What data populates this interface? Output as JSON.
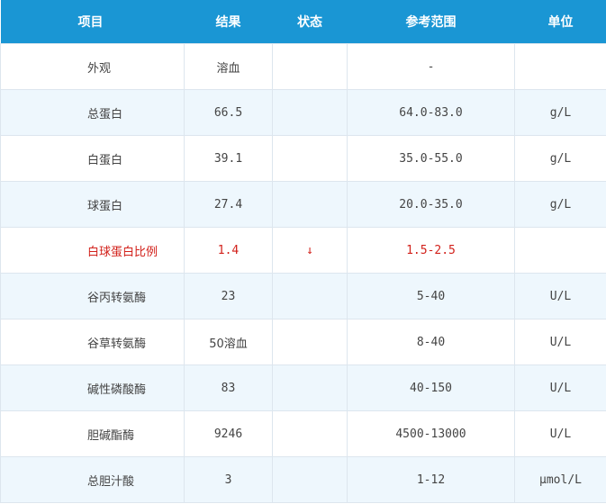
{
  "headers": {
    "item": "项目",
    "result": "结果",
    "status": "状态",
    "reference": "参考范围",
    "unit": "单位"
  },
  "rows": [
    {
      "item": "外观",
      "result": "溶血",
      "status": "",
      "reference": "-",
      "unit": ""
    },
    {
      "item": "总蛋白",
      "result": "66.5",
      "status": "",
      "reference": "64.0-83.0",
      "unit": "g/L"
    },
    {
      "item": "白蛋白",
      "result": "39.1",
      "status": "",
      "reference": "35.0-55.0",
      "unit": "g/L"
    },
    {
      "item": "球蛋白",
      "result": "27.4",
      "status": "",
      "reference": "20.0-35.0",
      "unit": "g/L"
    },
    {
      "item": "白球蛋白比例",
      "result": "1.4",
      "status": "↓",
      "reference": "1.5-2.5",
      "unit": ""
    },
    {
      "item": "谷丙转氨酶",
      "result": "23",
      "status": "",
      "reference": "5-40",
      "unit": "U/L"
    },
    {
      "item": "谷草转氨酶",
      "result": "50溶血",
      "status": "",
      "reference": "8-40",
      "unit": "U/L"
    },
    {
      "item": "碱性磷酸酶",
      "result": "83",
      "status": "",
      "reference": "40-150",
      "unit": "U/L"
    },
    {
      "item": "胆碱酯酶",
      "result": "9246",
      "status": "",
      "reference": "4500-13000",
      "unit": "U/L"
    },
    {
      "item": "总胆汁酸",
      "result": "3",
      "status": "",
      "reference": "1-12",
      "unit": "μmol/L"
    }
  ],
  "colors": {
    "header_bg": "#1a96d4",
    "header_text": "#ffffff",
    "row_alt_bg": "#eef7fd",
    "abnormal_text": "#d2211b",
    "normal_text": "#444444"
  }
}
